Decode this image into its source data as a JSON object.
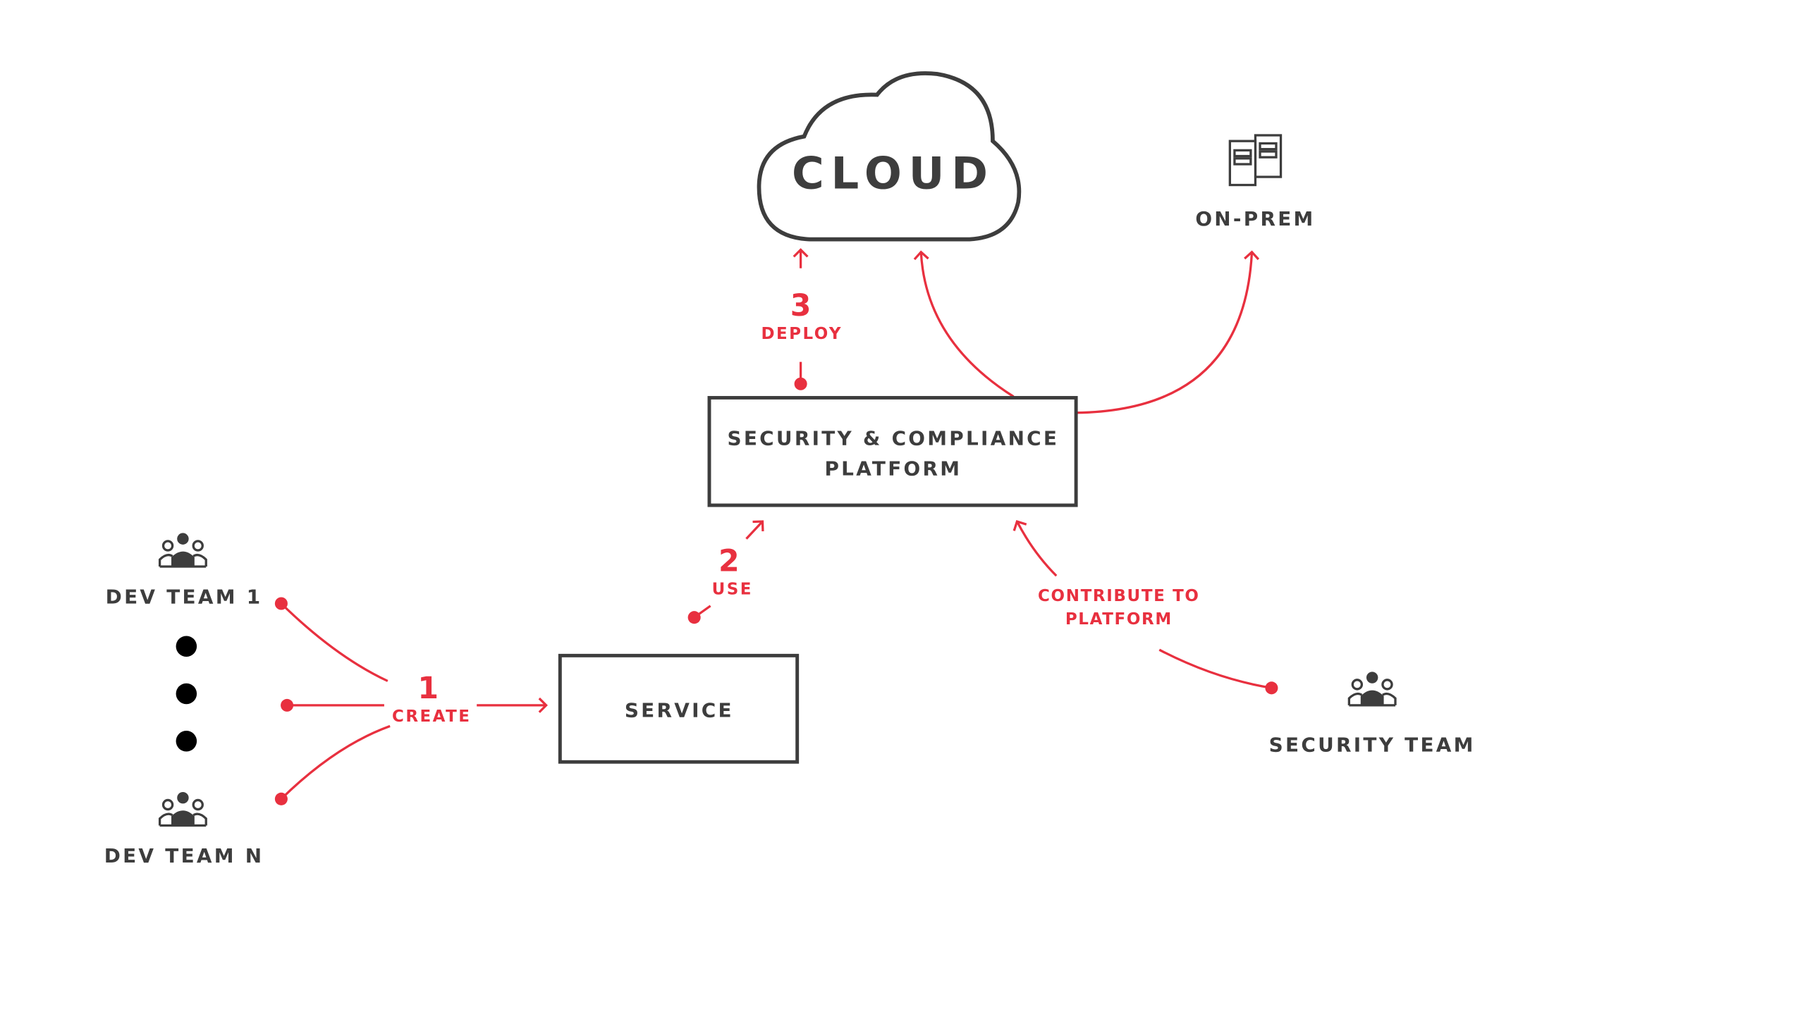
{
  "colors": {
    "accent": "#e8303f",
    "ink": "#3d3d3d"
  },
  "nodes": {
    "cloud": "CLOUD",
    "on_prem": "ON-PREM",
    "platform_line1": "SECURITY & COMPLIANCE",
    "platform_line2": "PLATFORM",
    "service": "SERVICE",
    "dev_team_1": "DEV TEAM 1",
    "dev_team_n": "DEV TEAM N",
    "security_team": "SECURITY TEAM"
  },
  "steps": {
    "create_num": "1",
    "create": "CREATE",
    "use_num": "2",
    "use": "USE",
    "deploy_num": "3",
    "deploy": "DEPLOY",
    "contribute_line1": "CONTRIBUTE TO",
    "contribute_line2": "PLATFORM"
  },
  "icons": [
    "cloud-icon",
    "server-icon",
    "team-icon"
  ]
}
